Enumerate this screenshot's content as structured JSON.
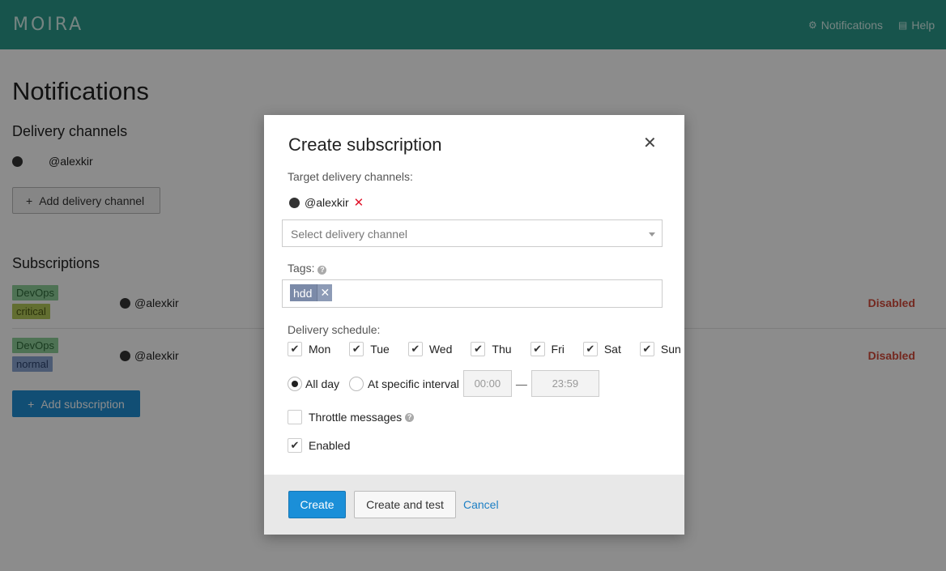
{
  "header": {
    "logo": "MOIRA",
    "notifications_label": "Notifications",
    "help_label": "Help"
  },
  "page": {
    "title": "Notifications",
    "delivery_channels_title": "Delivery channels",
    "channel_name": "@alexkir",
    "add_channel_label": "Add delivery channel",
    "subscriptions_title": "Subscriptions",
    "subscriptions": [
      {
        "tags": [
          "DevOps",
          "critical"
        ],
        "channel": "@alexkir",
        "status": "Disabled"
      },
      {
        "tags": [
          "DevOps",
          "normal"
        ],
        "channel": "@alexkir",
        "status": "Disabled"
      }
    ],
    "add_subscription_label": "Add subscription"
  },
  "modal": {
    "title": "Create subscription",
    "close": "✕",
    "target_label": "Target delivery channels:",
    "selected_channel": "@alexkir",
    "remove_glyph": "✕",
    "select_placeholder": "Select delivery channel",
    "tags_label": "Tags:",
    "tags": [
      {
        "name": "hdd",
        "remove": "✕"
      }
    ],
    "schedule_label": "Delivery schedule:",
    "days": [
      {
        "label": "Mon",
        "checked": true
      },
      {
        "label": "Tue",
        "checked": true
      },
      {
        "label": "Wed",
        "checked": true
      },
      {
        "label": "Thu",
        "checked": true
      },
      {
        "label": "Fri",
        "checked": true
      },
      {
        "label": "Sat",
        "checked": true
      },
      {
        "label": "Sun",
        "checked": true
      }
    ],
    "all_day_label": "All day",
    "interval_label": "At specific interval",
    "time_from": "00:00",
    "time_dash": "—",
    "time_to": "23:59",
    "throttle_label": "Throttle messages",
    "enabled_label": "Enabled",
    "create_label": "Create",
    "create_test_label": "Create and test",
    "cancel_label": "Cancel"
  },
  "colors": {
    "header_bg": "#2b9a8b",
    "primary": "#1b8fd8",
    "disabled": "#d34a3a",
    "tag_devops": "#8fcf9a",
    "tag_critical": "#b3c95a",
    "tag_normal": "#8ba6d4"
  }
}
